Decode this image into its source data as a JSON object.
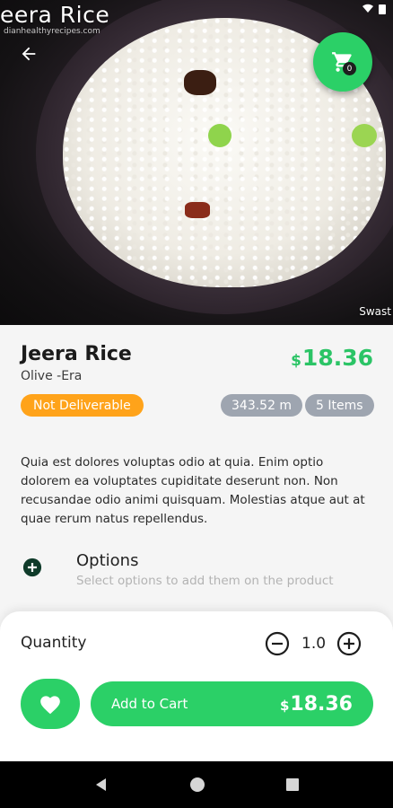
{
  "hero": {
    "overlay_title": "eera Rice",
    "overlay_source": "dianhealthyrecipes.com",
    "watermark": "Swast"
  },
  "cart": {
    "count": "0"
  },
  "product": {
    "name": "Jeera Rice",
    "restaurant": "Olive -Era",
    "currency": "$",
    "price": "18.36",
    "delivery_status": "Not Deliverable",
    "distance": "343.52 m",
    "items": "5 Items",
    "description": "Quia est dolores voluptas odio at quia. Enim optio dolorem ea voluptates cupiditate deserunt non. Non recusandae odio animi quisquam. Molestias atque aut at quae rerum natus repellendus."
  },
  "options": {
    "title": "Options",
    "subtitle": "Select options to add them on the product"
  },
  "order": {
    "quantity_label": "Quantity",
    "quantity": "1.0",
    "add_to_cart_label": "Add to Cart",
    "currency": "$",
    "total": "18.36"
  },
  "colors": {
    "accent_green": "#2bd067",
    "price_green": "#2bc466",
    "warning_orange": "#ffa31a",
    "chip_gray": "#9ea5b0"
  },
  "icons": {
    "back": "arrow-left-icon",
    "cart": "shopping-cart-icon",
    "options": "plus-circle-icon",
    "minus": "minus-circle-icon",
    "plus": "plus-circle-outline-icon",
    "favorite": "heart-icon",
    "nav_back": "nav-back-triangle-icon",
    "nav_home": "nav-home-circle-icon",
    "nav_recents": "nav-recents-square-icon"
  }
}
